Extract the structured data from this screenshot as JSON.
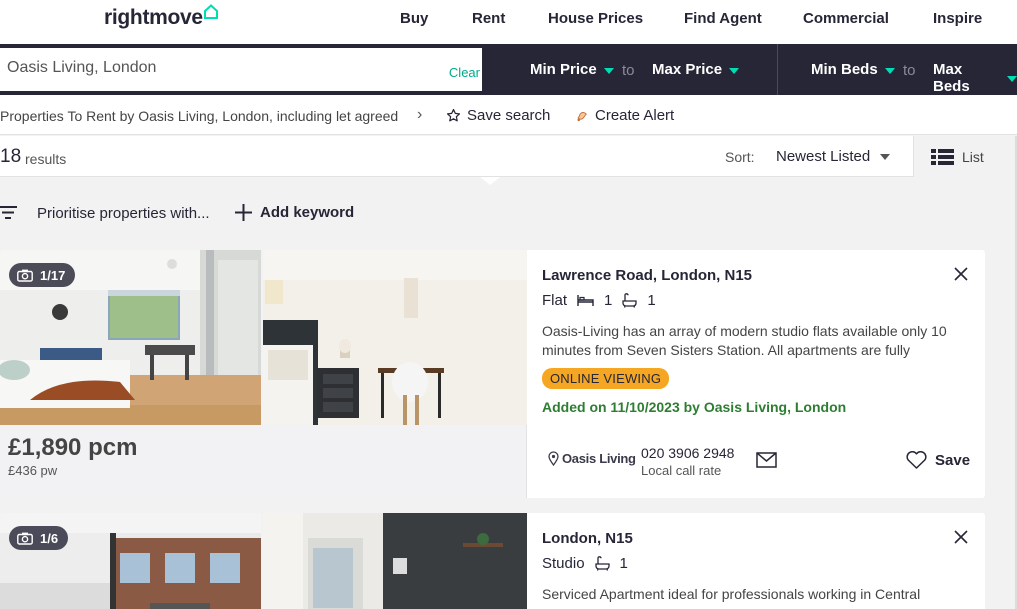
{
  "header": {
    "logo": "rightmove",
    "nav": [
      "Buy",
      "Rent",
      "House Prices",
      "Find Agent",
      "Commercial",
      "Inspire"
    ]
  },
  "search": {
    "value": "Oasis Living, London",
    "clear_label": "Clear",
    "min_price": "Min Price",
    "max_price": "Max Price",
    "min_beds": "Min Beds",
    "max_beds": "Max Beds",
    "to_label": "to"
  },
  "breadcrumb": {
    "text": "Properties To Rent by Oasis Living, London, including let agreed",
    "save_search": "Save search",
    "create_alert": "Create Alert"
  },
  "results": {
    "count": "18",
    "count_label": "results",
    "sort_label": "Sort:",
    "sort_value": "Newest Listed",
    "view_label": "List"
  },
  "keywords": {
    "prioritise": "Prioritise properties with...",
    "add_keyword": "Add keyword"
  },
  "listings": [
    {
      "photo_count": "1/17",
      "price": "£1,890 pcm",
      "price_pw": "£436 pw",
      "address": "Lawrence Road, London, N15",
      "type": "Flat",
      "beds": "1",
      "baths": "1",
      "description": "Oasis-Living has an array of modern studio flats available only 10 minutes from Seven Sisters Station. All apartments are fully",
      "tag": "ONLINE VIEWING",
      "added": "Added on 11/10/2023 by Oasis Living, London",
      "agent": "Oasis Living",
      "phone": "020 3906 2948",
      "call_rate": "Local call rate",
      "save_label": "Save"
    },
    {
      "photo_count": "1/6",
      "address": "London, N15",
      "type": "Studio",
      "baths": "1",
      "description": "Serviced Apartment ideal for professionals working in Central"
    }
  ],
  "colors": {
    "brand_dark": "#262637",
    "accent": "#00deb6",
    "tag_bg": "#f5a623",
    "added_green": "#2e7d32"
  }
}
